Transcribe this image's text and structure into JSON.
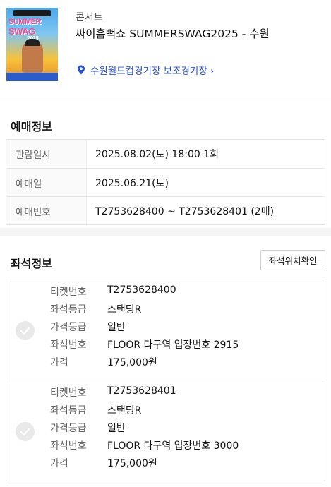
{
  "event": {
    "category": "콘서트",
    "title": "싸이흠뻑쇼 SUMMERSWAG2025 - 수원",
    "venue": "수원월드컵경기장 보조경기장 ›",
    "poster": {
      "brand_line1": "SUMMER",
      "brand_line2": "SWAG",
      "year": "2025"
    }
  },
  "booking": {
    "title": "예매정보",
    "rows": [
      {
        "label": "관람일시",
        "value": "2025.08.02(토) 18:00 1회"
      },
      {
        "label": "예매일",
        "value": "2025.06.21(토)"
      },
      {
        "label": "예매번호",
        "value": "T2753628400 ~ T2753628401 (2매)"
      }
    ]
  },
  "seats": {
    "title": "좌석정보",
    "button_label": "좌석위치확인",
    "tickets": [
      {
        "rows": [
          {
            "label": "티켓번호",
            "value": "T2753628400"
          },
          {
            "label": "좌석등급",
            "value": "스탠딩R"
          },
          {
            "label": "가격등급",
            "value": "일반"
          },
          {
            "label": "좌석번호",
            "value": "FLOOR 다구역 입장번호 2915"
          },
          {
            "label": "가격",
            "value": "175,000원"
          }
        ]
      },
      {
        "rows": [
          {
            "label": "티켓번호",
            "value": "T2753628401"
          },
          {
            "label": "좌석등급",
            "value": "스탠딩R"
          },
          {
            "label": "가격등급",
            "value": "일반"
          },
          {
            "label": "좌석번호",
            "value": "FLOOR 다구역 입장번호 3000"
          },
          {
            "label": "가격",
            "value": "175,000원"
          }
        ]
      }
    ]
  },
  "colors": {
    "link": "#2751d3",
    "divider": "#e3e3e3",
    "section_bg": "#f4f4f4"
  }
}
